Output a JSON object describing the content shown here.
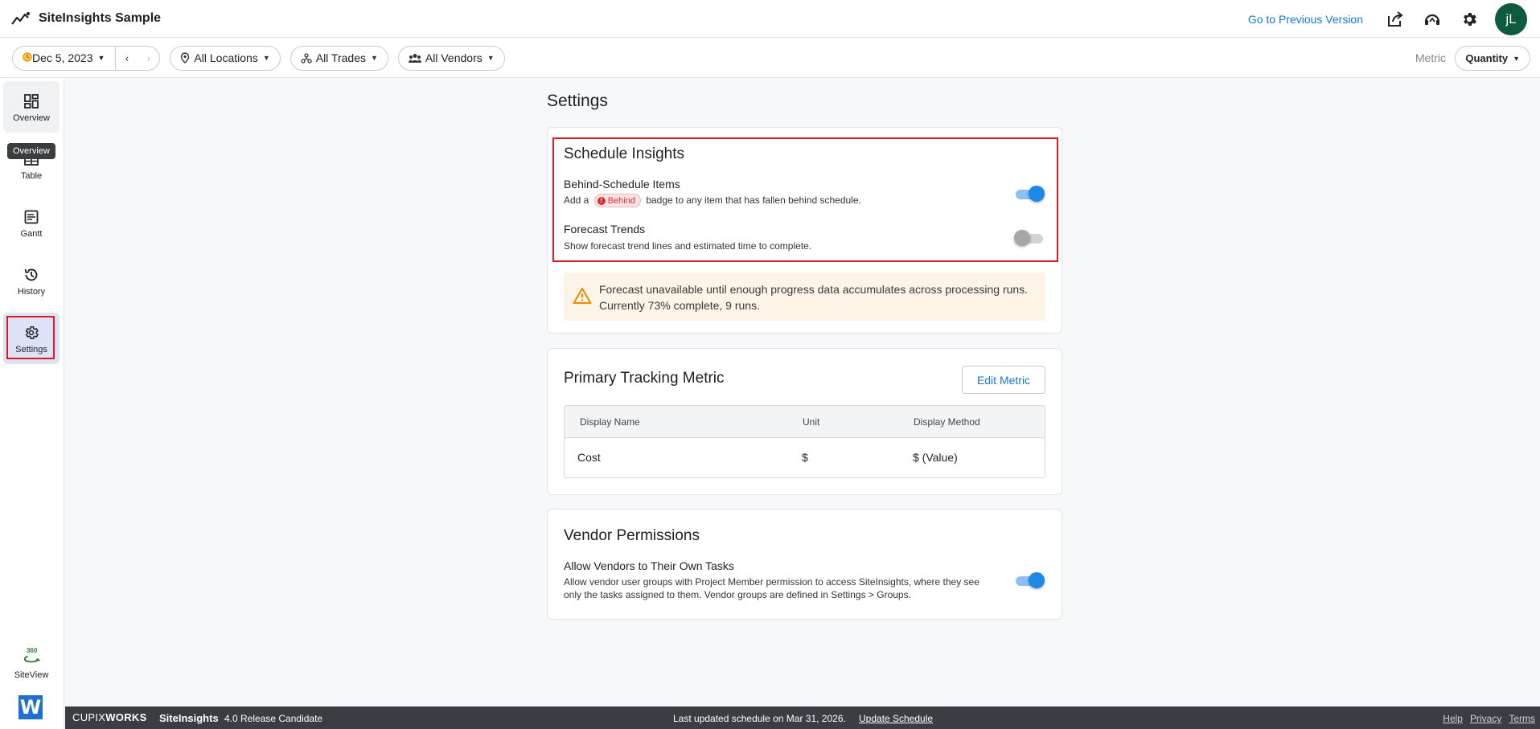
{
  "app": {
    "title": "SiteInsights Sample"
  },
  "header": {
    "previous_version": "Go to Previous Version",
    "avatar_initials": "jL",
    "icons": [
      "share-icon",
      "support-icon",
      "gear-icon"
    ]
  },
  "filters": {
    "date": "Dec 5, 2023",
    "prev": "‹",
    "next": "›",
    "locations": "All Locations",
    "trades": "All Trades",
    "vendors": "All Vendors",
    "metric_label": "Metric",
    "metric_value": "Quantity"
  },
  "sidebar": {
    "items": [
      {
        "label": "Overview",
        "icon": "dashboard-icon"
      },
      {
        "label": "Table",
        "icon": "table-icon"
      },
      {
        "label": "Gantt",
        "icon": "gantt-icon"
      },
      {
        "label": "History",
        "icon": "history-icon"
      },
      {
        "label": "Settings",
        "icon": "gear-icon",
        "active": true
      }
    ],
    "tooltip": "Overview",
    "siteview": "SiteView",
    "siteview_badge": "360",
    "w_logo": "W"
  },
  "settings": {
    "title": "Settings",
    "schedule": {
      "title": "Schedule Insights",
      "behind_title": "Behind-Schedule Items",
      "behind_desc_before": "Add a",
      "behind_badge": "Behind",
      "behind_badge_glyph": "!",
      "behind_desc_after": "badge to any item that has fallen behind schedule.",
      "behind_enabled": true,
      "forecast_title": "Forecast Trends",
      "forecast_desc": "Show forecast trend lines and estimated time to complete.",
      "forecast_enabled": false,
      "warning_line1": "Forecast unavailable until enough progress data accumulates across processing runs.",
      "warning_line2": "Currently 73% complete, 9 runs."
    },
    "metric": {
      "title": "Primary Tracking Metric",
      "edit_button": "Edit Metric",
      "columns": [
        "Display Name",
        "Unit",
        "Display Method"
      ],
      "row": [
        "Cost",
        "$",
        "$ (Value)"
      ]
    },
    "vendor": {
      "title": "Vendor Permissions",
      "allow_title": "Allow Vendors to Their Own Tasks",
      "allow_desc_line1": "Allow vendor user groups with Project Member permission to access SiteInsights, where they see",
      "allow_desc_line2": "only the tasks assigned to them. Vendor groups are defined in Settings > Groups.",
      "allow_enabled": true
    }
  },
  "footer": {
    "brand_a": "CUPIX",
    "brand_b": "WORKS",
    "product": "SiteInsights",
    "version": "4.0 Release Candidate",
    "updated": "Last updated schedule on Mar 31, 2026.",
    "update_link": "Update Schedule",
    "links": [
      "Help",
      "Privacy",
      "Terms"
    ]
  },
  "colors": {
    "accent": "#1976d2",
    "toggle_on": "#1e88e5",
    "highlight": "#e0191f",
    "warning_bg": "#fdf3e6",
    "avatar": "#0e5a3c",
    "footer_bg": "#3a3d41"
  }
}
